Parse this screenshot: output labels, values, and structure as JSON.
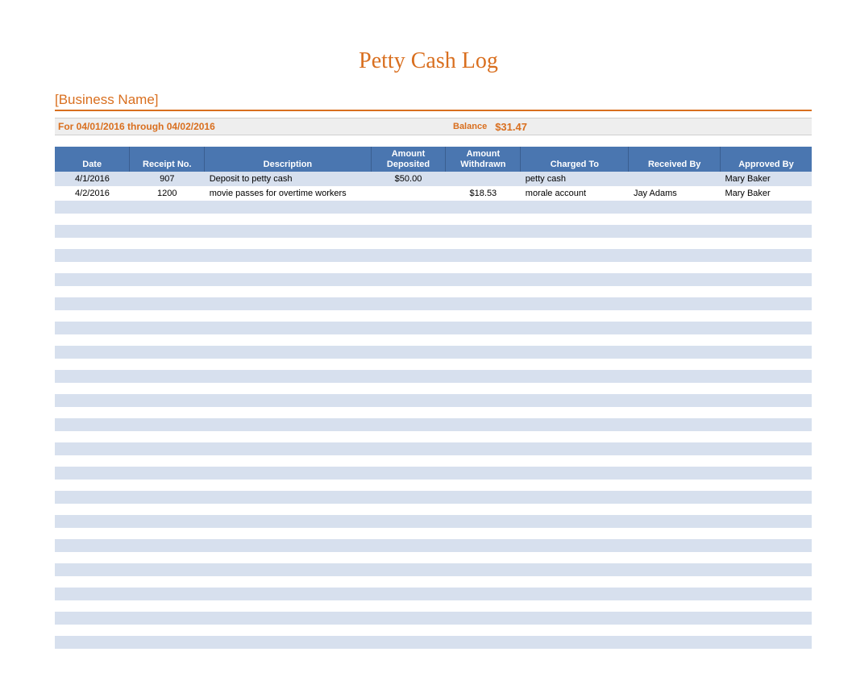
{
  "title": "Petty Cash Log",
  "business_name": "[Business Name]",
  "period": "For 04/01/2016 through 04/02/2016",
  "balance_label": "Balance",
  "balance_value": "$31.47",
  "columns": {
    "date": "Date",
    "receipt": "Receipt No.",
    "description": "Description",
    "deposited": "Amount\nDeposited",
    "withdrawn": "Amount\nWithdrawn",
    "charged_to": "Charged To",
    "received_by": "Received By",
    "approved_by": "Approved By"
  },
  "rows": [
    {
      "date": "4/1/2016",
      "receipt": "907",
      "description": "Deposit to petty cash",
      "deposited": "$50.00",
      "withdrawn": "",
      "charged_to": "petty cash",
      "received_by": "",
      "approved_by": "Mary Baker"
    },
    {
      "date": "4/2/2016",
      "receipt": "1200",
      "description": "movie passes for overtime workers",
      "deposited": "",
      "withdrawn": "$18.53",
      "charged_to": "morale account",
      "received_by": "Jay Adams",
      "approved_by": "Mary Baker"
    }
  ],
  "empty_row_count": 37
}
